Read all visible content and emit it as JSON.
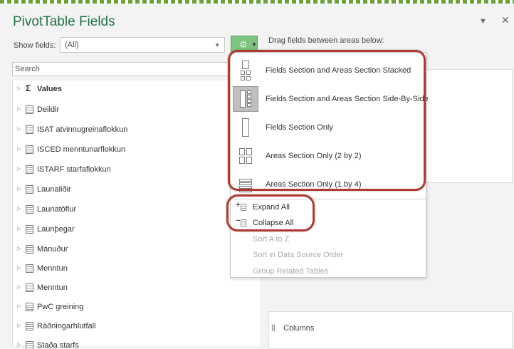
{
  "pane": {
    "title": "PivotTable Fields",
    "pin_icon": "▼",
    "close_icon": "✕"
  },
  "show_fields": {
    "label": "Show fields:",
    "value": "(All)"
  },
  "toolbar": {
    "tools_icon": "gear-icon",
    "drag_hint": "Drag fields between areas below:"
  },
  "search": {
    "placeholder": "Search"
  },
  "fields": [
    {
      "label": "Values",
      "type": "sigma"
    },
    {
      "label": "Deildir",
      "type": "table"
    },
    {
      "label": "ISAT atvinnugreinaflokkun",
      "type": "table"
    },
    {
      "label": "ISCED menntunarflokkun",
      "type": "table"
    },
    {
      "label": "ISTARF starfaflokkun",
      "type": "table"
    },
    {
      "label": "Launaliðir",
      "type": "table"
    },
    {
      "label": "Launatöflur",
      "type": "table"
    },
    {
      "label": "Launþegar",
      "type": "table"
    },
    {
      "label": "Mánuður",
      "type": "table"
    },
    {
      "label": "Menntun",
      "type": "table"
    },
    {
      "label": "Menntun",
      "type": "table"
    },
    {
      "label": "PwC greining",
      "type": "table"
    },
    {
      "label": "Ráðningarhlutfall",
      "type": "table"
    },
    {
      "label": "Staða starfs",
      "type": "table"
    }
  ],
  "areas": {
    "columns_label": "Columns"
  },
  "menu": {
    "layouts": [
      {
        "label": "Fields Section and Areas Section Stacked",
        "selected": false
      },
      {
        "label": "Fields Section and Areas Section Side-By-Side",
        "selected": true
      },
      {
        "label": "Fields Section Only",
        "selected": false
      },
      {
        "label": "Areas Section Only (2 by 2)",
        "selected": false
      },
      {
        "label": "Areas Section Only (1 by 4)",
        "selected": false
      }
    ],
    "expand_all": "Expand All",
    "collapse_all": "Collapse All",
    "sort_az": "Sort A to Z",
    "sort_source": "Sort in Data Source Order",
    "group_tables": "Group Related Tables"
  },
  "colors": {
    "title_green": "#217346",
    "tools_button": "#7cc47f",
    "highlight_ring": "#b03a2e"
  }
}
